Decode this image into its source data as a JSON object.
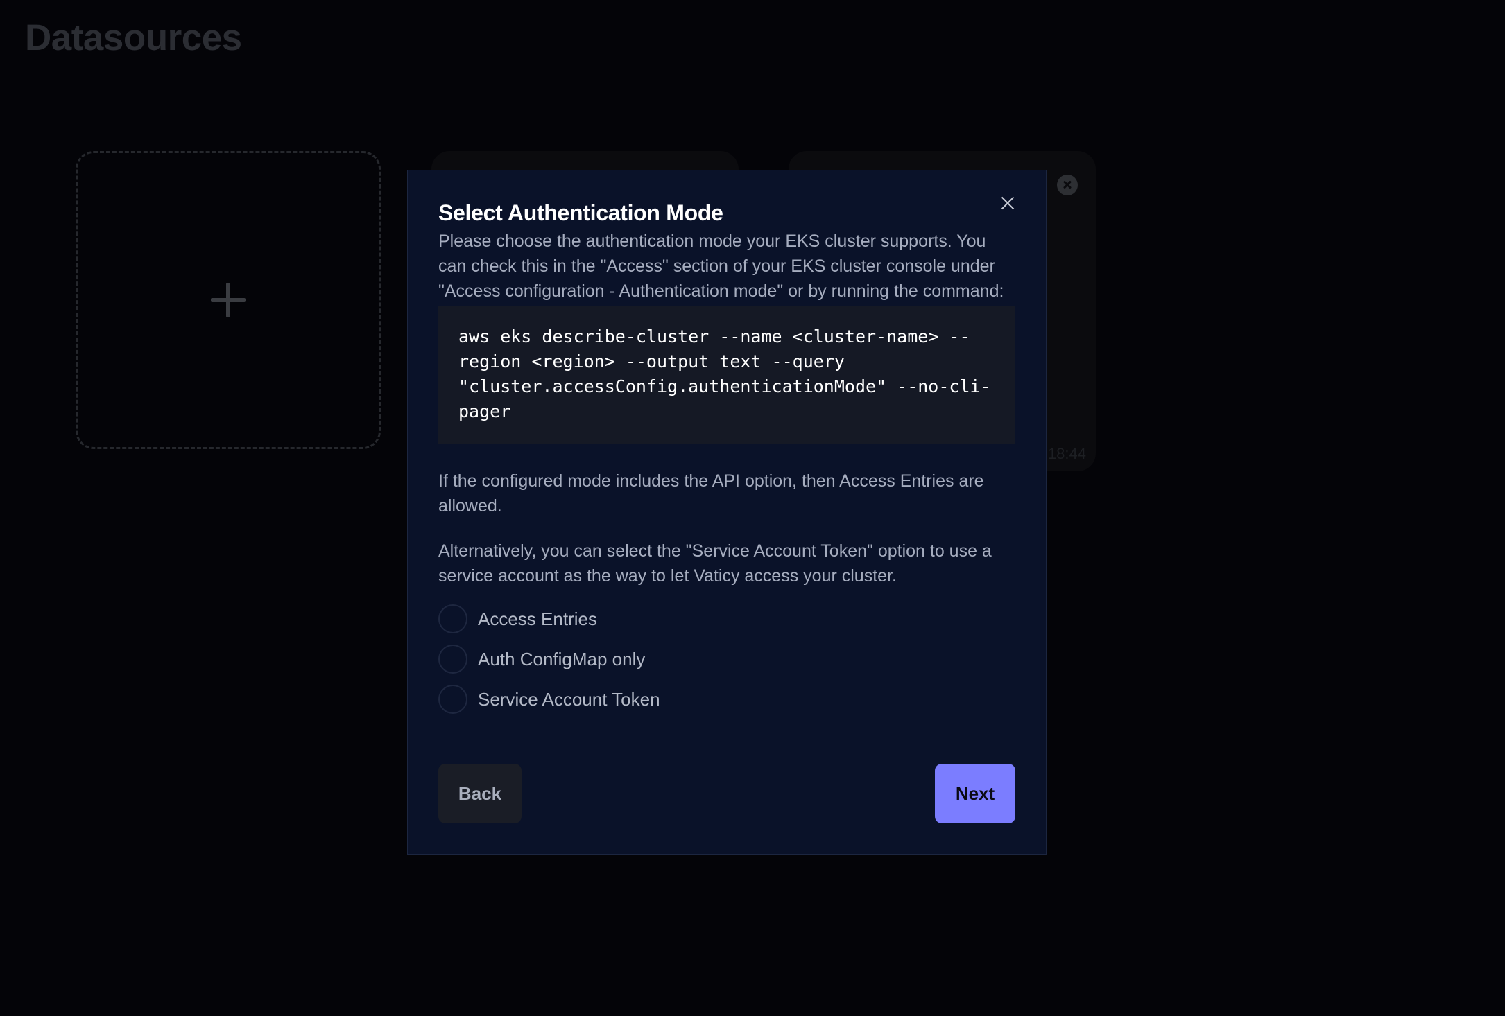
{
  "page": {
    "title": "Datasources"
  },
  "datasource_cards": [
    {
      "timestamp": "18:44"
    }
  ],
  "modal": {
    "title": "Select Authentication Mode",
    "intro": "Please choose the authentication mode your EKS cluster supports. You can check this in the \"Access\" section of your EKS cluster console under \"Access configuration - Authentication mode\" or by running the command:",
    "command": "aws eks describe-cluster --name <cluster-name> --\nregion <region> --output text --query\n\"cluster.accessConfig.authenticationMode\" --no-cli-\npager",
    "api_note": "If the configured mode includes the API option, then Access Entries are allowed.",
    "alternative_note": "Alternatively, you can select the \"Service Account Token\" option to use a service account as the way to let Vaticy access your cluster.",
    "options": [
      {
        "label": "Access Entries",
        "selected": false
      },
      {
        "label": "Auth ConfigMap only",
        "selected": false
      },
      {
        "label": "Service Account Token",
        "selected": false
      }
    ],
    "back_label": "Back",
    "next_label": "Next"
  },
  "colors": {
    "background": "#040408",
    "modal_background": "#0a1229",
    "accent": "#7b7dff"
  },
  "icons": [
    "plus-icon",
    "remove-icon",
    "close-icon"
  ]
}
